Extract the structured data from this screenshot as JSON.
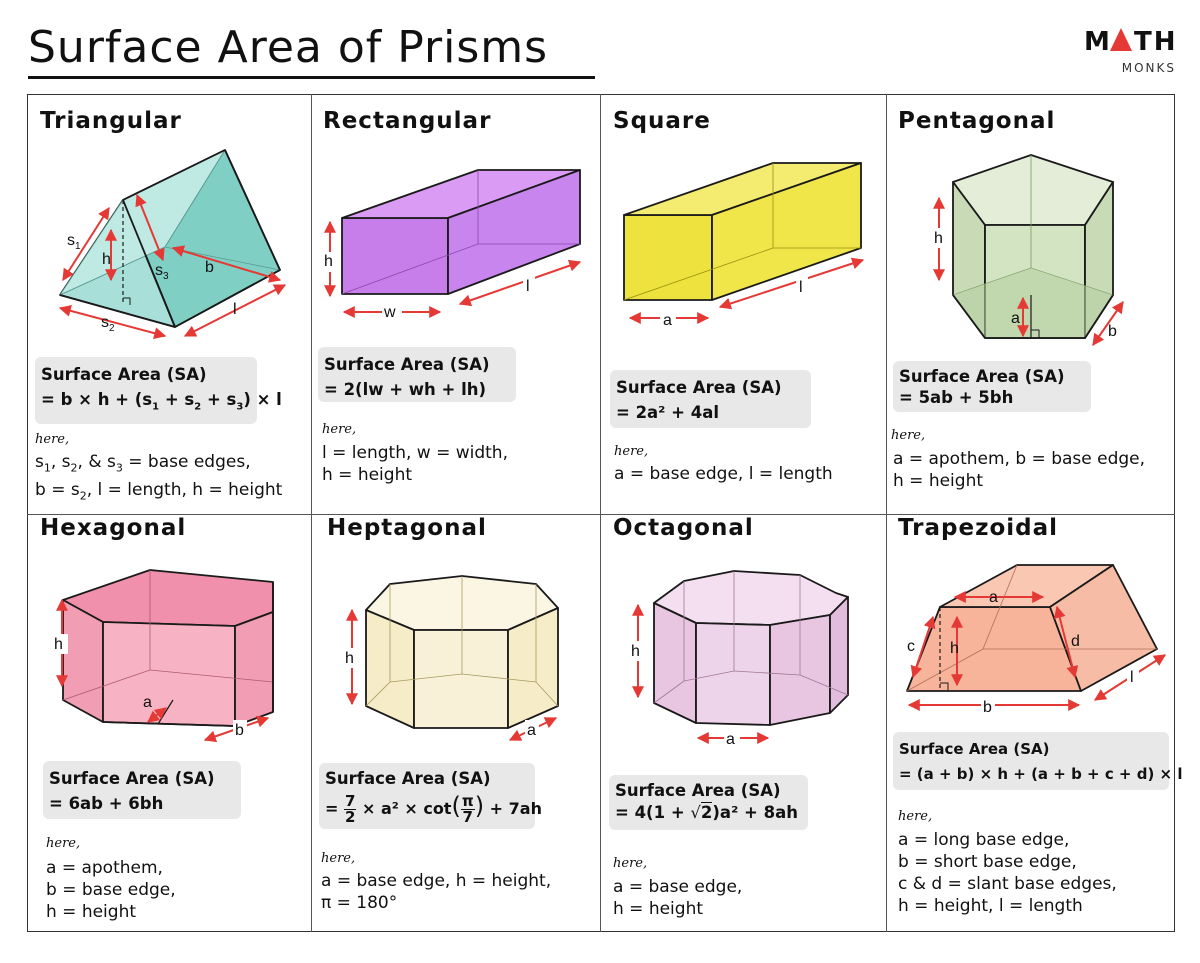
{
  "title": "Surface Area of Prisms",
  "logo": {
    "main": "MATH",
    "sub": "MONKS",
    "accent": "#e53935"
  },
  "colors": {
    "arrow": "#e53935",
    "border": "#333333",
    "formula_bg": "#e8e8e8"
  },
  "cells": [
    {
      "name": "Triangular",
      "sa_label": "Surface Area (SA)",
      "formula": "= b × h + (s1 + s2 + s3) × l",
      "here": "here,",
      "notes": [
        "s1, s2, & s3 = base edges,",
        "b = s2, l = length, h = height"
      ],
      "fig_labels": {
        "s1": "s1",
        "s2": "s2",
        "s3": "s3",
        "h": "h",
        "b": "b",
        "l": "l"
      },
      "color": "#7fcfc4"
    },
    {
      "name": "Rectangular",
      "sa_label": "Surface Area (SA)",
      "formula": "= 2(lw + wh + lh)",
      "here": "here,",
      "notes": [
        "l = length, w = width,",
        "h = height"
      ],
      "fig_labels": {
        "h": "h",
        "w": "w",
        "l": "l"
      },
      "color": "#c77dea"
    },
    {
      "name": "Square",
      "sa_label": "Surface Area (SA)",
      "formula": "= 2a² + 4al",
      "here": "here,",
      "notes": [
        "a = base edge, l = length"
      ],
      "fig_labels": {
        "a": "a",
        "l": "l"
      },
      "color": "#f0e64a"
    },
    {
      "name": "Pentagonal",
      "sa_label": "Surface Area (SA)",
      "formula": "= 5ab + 5bh",
      "here": "here,",
      "notes": [
        "a = apothem, b = base edge,",
        "h = height"
      ],
      "fig_labels": {
        "h": "h",
        "a": "a",
        "b": "b"
      },
      "color": "#d3e4c3"
    },
    {
      "name": "Hexagonal",
      "sa_label": "Surface Area (SA)",
      "formula": "= 6ab + 6bh",
      "here": "here,",
      "notes": [
        "a = apothem,",
        "b = base edge,",
        "h = height"
      ],
      "fig_labels": {
        "h": "h",
        "a": "a",
        "b": "b"
      },
      "color": "#f4a7bb"
    },
    {
      "name": "Heptagonal",
      "sa_label": "Surface Area (SA)",
      "formula_parts": {
        "eq": "=",
        "num": "7",
        "den": "2",
        "mid": "× a² × cot",
        "pi": "π",
        "seven": "7",
        "tail": "+ 7ah"
      },
      "here": "here,",
      "notes": [
        "a = base edge, h = height,",
        "π = 180°"
      ],
      "fig_labels": {
        "h": "h",
        "a": "a"
      },
      "color": "#f6efd6"
    },
    {
      "name": "Octagonal",
      "sa_label": "Surface Area (SA)",
      "formula_parts": {
        "pre": "= 4(1 + ",
        "root": "2",
        "post": ")a² + 8ah"
      },
      "here": "here,",
      "notes": [
        "a = base edge,",
        "h = height"
      ],
      "fig_labels": {
        "h": "h",
        "a": "a"
      },
      "color": "#ecd3e8"
    },
    {
      "name": "Trapezoidal",
      "sa_label": "Surface Area (SA)",
      "formula": "= (a + b) × h + (a + b + c + d) × l",
      "here": "here,",
      "notes": [
        "a = long base edge,",
        "b = short base edge,",
        "c & d = slant base edges,",
        "h = height, l = length"
      ],
      "fig_labels": {
        "a": "a",
        "b": "b",
        "c": "c",
        "d": "d",
        "h": "h",
        "l": "l"
      },
      "color": "#f8c2ae"
    }
  ]
}
